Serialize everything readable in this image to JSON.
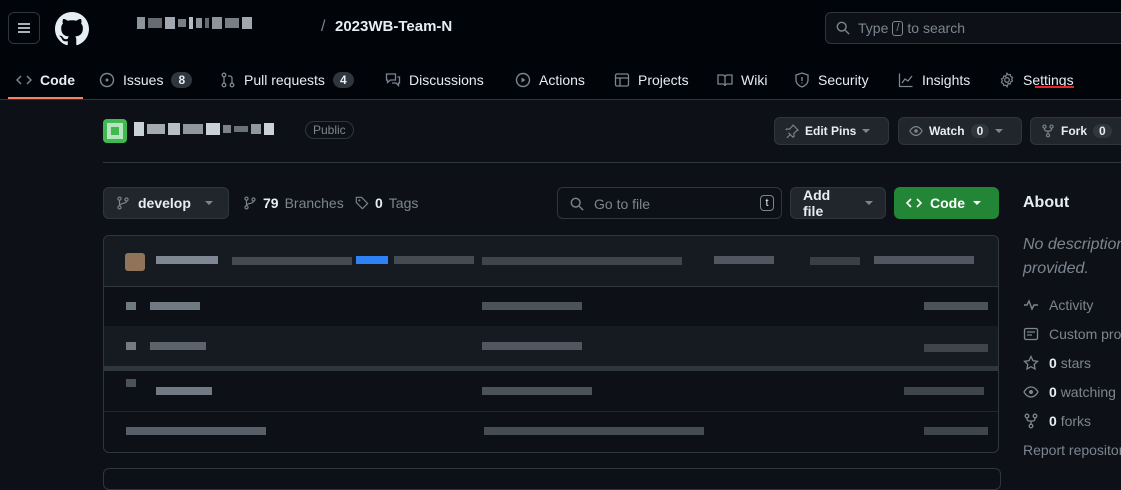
{
  "header": {
    "repo_name": "2023WB-Team-N",
    "search_placeholder_pre": "Type",
    "search_key": "/",
    "search_placeholder_post": "to search"
  },
  "nav": {
    "code": "Code",
    "issues": "Issues",
    "issues_count": "8",
    "pulls": "Pull requests",
    "pulls_count": "4",
    "discussions": "Discussions",
    "actions": "Actions",
    "projects": "Projects",
    "wiki": "Wiki",
    "security": "Security",
    "insights": "Insights",
    "settings": "Settings"
  },
  "repo_header": {
    "visibility": "Public",
    "edit_pins": "Edit Pins",
    "watch": "Watch",
    "watch_count": "0",
    "fork": "Fork",
    "fork_count": "0"
  },
  "toolbar": {
    "branch": "develop",
    "branches_count": "79",
    "branches_label": "Branches",
    "tags_count": "0",
    "tags_label": "Tags",
    "goto_placeholder": "Go to file",
    "goto_key": "t",
    "add_file": "Add file",
    "code_button": "Code"
  },
  "about": {
    "title": "About",
    "description_line1": "No description,",
    "description_line2": "provided.",
    "activity": "Activity",
    "custom_props": "Custom properties",
    "stars_count": "0",
    "stars_label": "stars",
    "watching_count": "0",
    "watching_label": "watching",
    "forks_count": "0",
    "forks_label": "forks",
    "report": "Report repository"
  },
  "colors": {
    "accent_underline_active": "#f78166",
    "settings_underline": "#e5252a",
    "code_button": "#238636"
  }
}
